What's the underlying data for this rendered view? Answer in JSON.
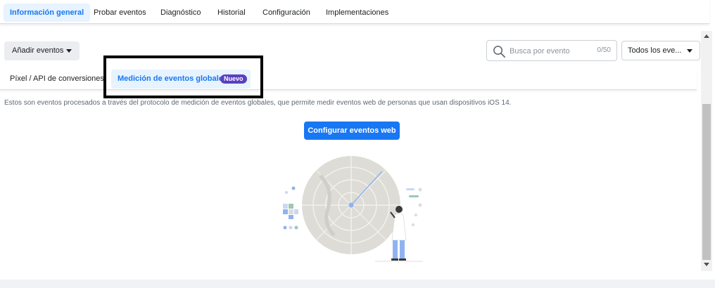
{
  "top_tabs": [
    {
      "label": "Información general",
      "active": true
    },
    {
      "label": "Probar eventos",
      "active": false
    },
    {
      "label": "Diagnóstico",
      "active": false
    },
    {
      "label": "Historial",
      "active": false
    },
    {
      "label": "Configuración",
      "active": false
    },
    {
      "label": "Implementaciones",
      "active": false
    }
  ],
  "toolbar": {
    "add_events_label": "Añadir eventos",
    "search_placeholder": "Busca por evento",
    "search_value": "",
    "search_count": "0/50",
    "filter_selected": "Todos los eve..."
  },
  "sub_tabs": {
    "pixel_label": "Píxel / API de conversiones",
    "global_label": "Medición de eventos globales",
    "global_badge": "Nuevo"
  },
  "description": "Estos son eventos procesados a través del protocolo de medición de eventos globales, que permite medir eventos web de personas que usan dispositivos iOS 14.",
  "cta_label": "Configurar eventos web",
  "colors": {
    "accent": "#1877f2",
    "active_tab_bg": "#e7f3ff",
    "badge": "#5b3fbf"
  },
  "icons": {
    "search": "search-icon",
    "add_caret": "caret-down-icon",
    "select_caret": "caret-down-icon"
  }
}
